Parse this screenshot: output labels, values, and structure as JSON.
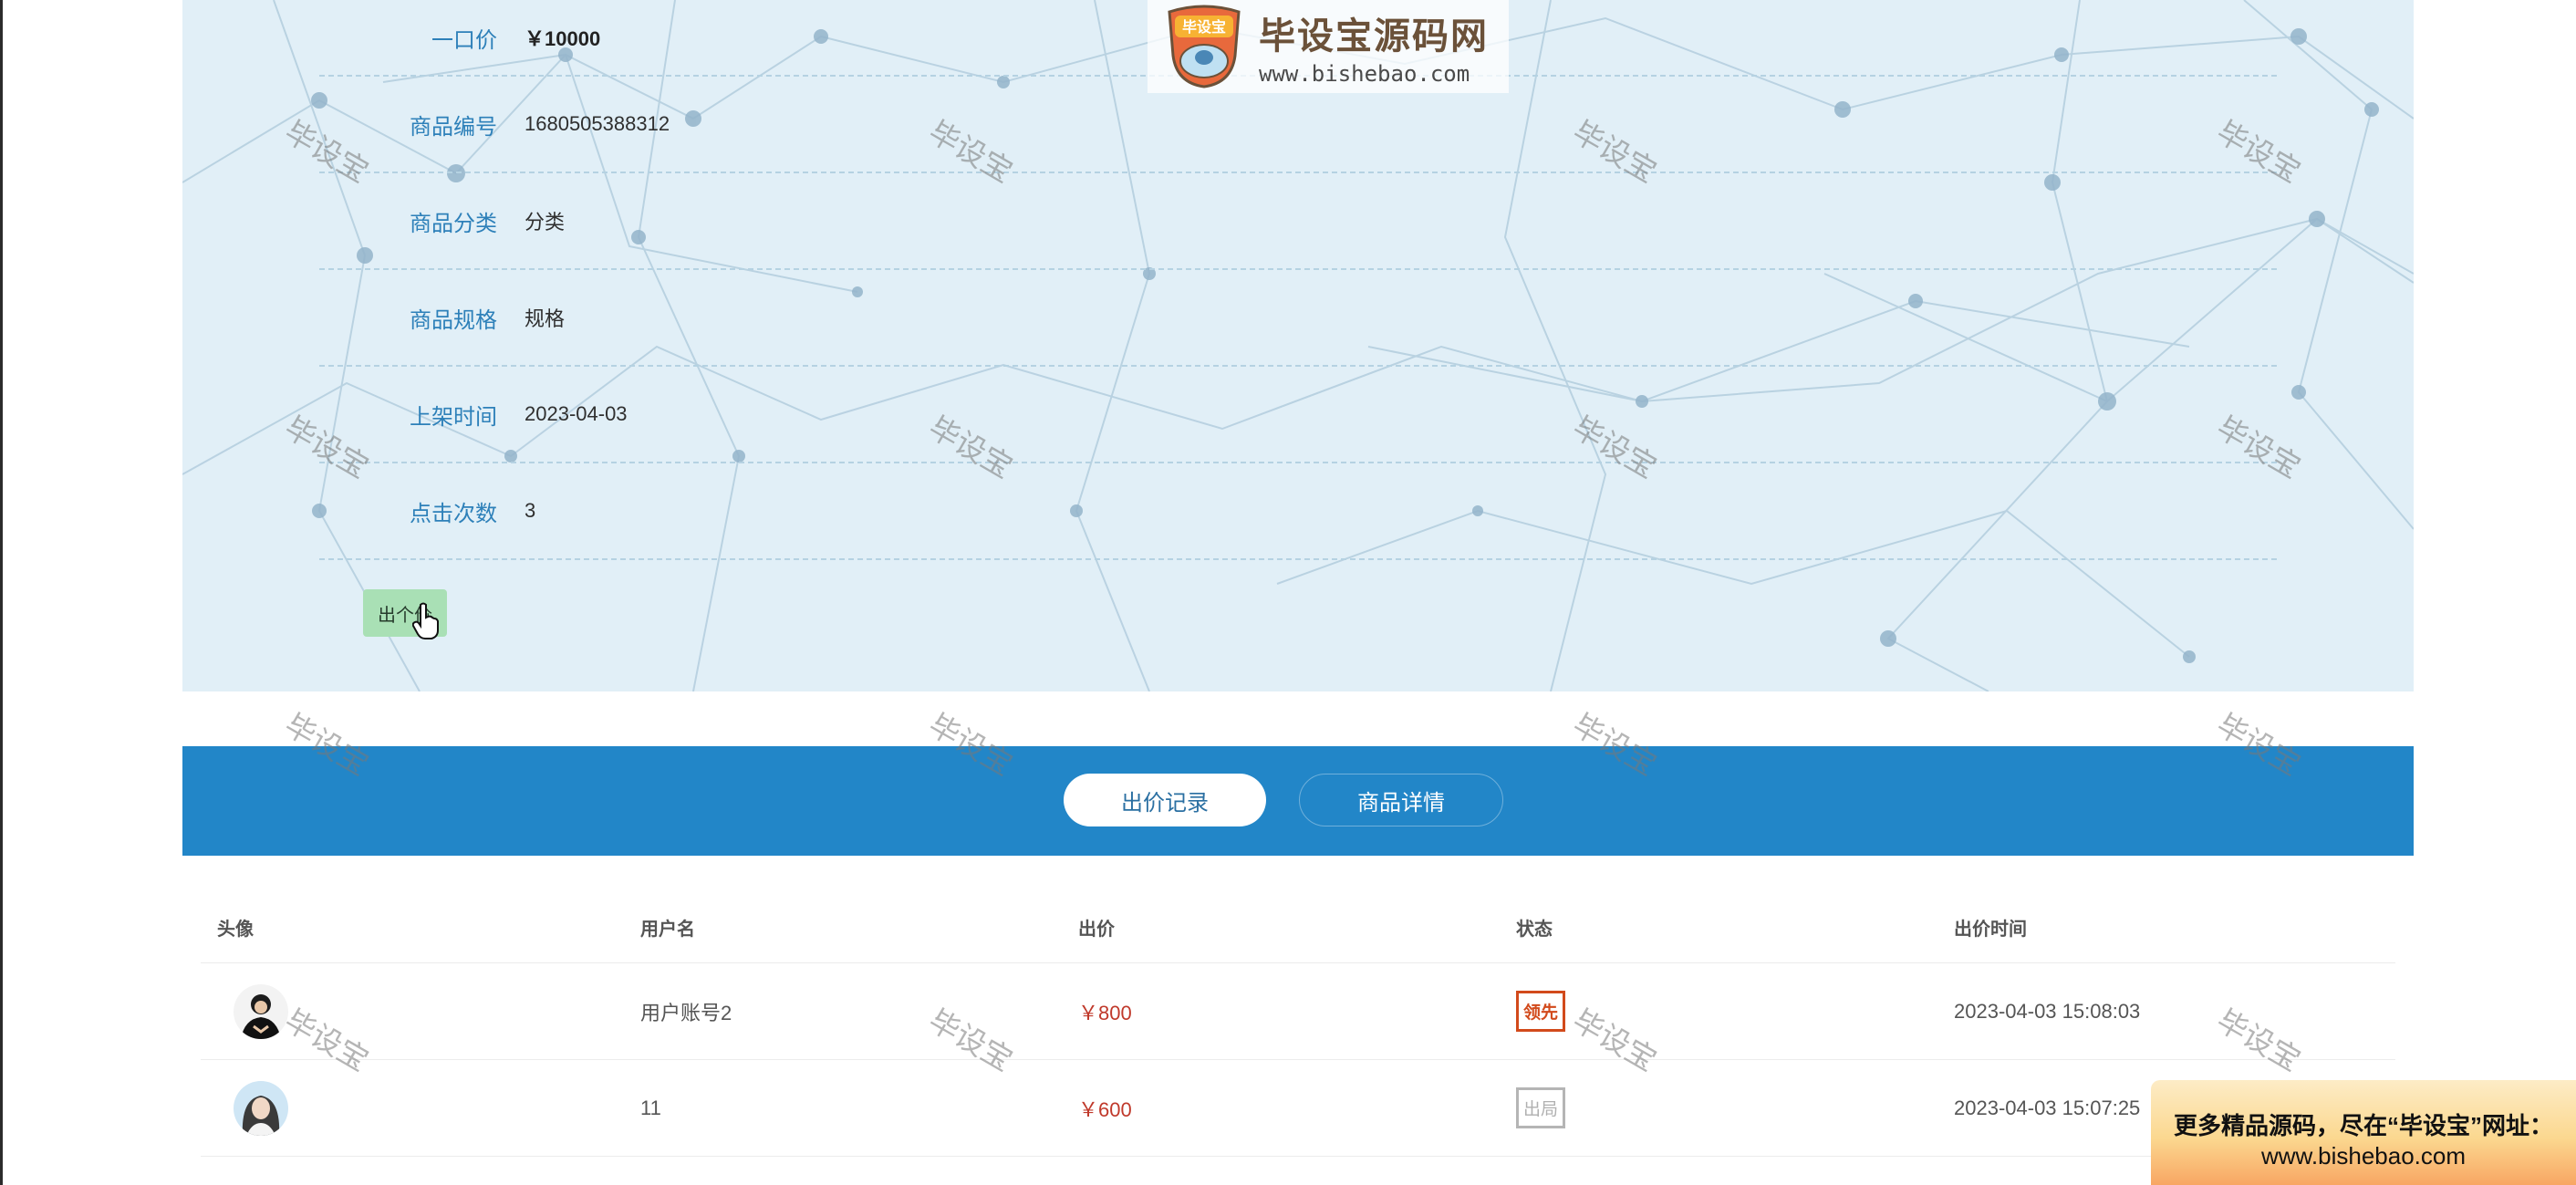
{
  "logo": {
    "title": "毕设宝源码网",
    "url": "www.bishebao.com",
    "badge": "毕设宝"
  },
  "product_info": [
    {
      "label": "一口价",
      "value": "￥10000"
    },
    {
      "label": "商品编号",
      "value": "1680505388312"
    },
    {
      "label": "商品分类",
      "value": "分类"
    },
    {
      "label": "商品规格",
      "value": "规格"
    },
    {
      "label": "上架时间",
      "value": "2023-04-03"
    },
    {
      "label": "点击次数",
      "value": "3"
    }
  ],
  "actions": {
    "bid_label": "出个价"
  },
  "tabs": [
    {
      "label": "出价记录",
      "active": true
    },
    {
      "label": "商品详情",
      "active": false
    }
  ],
  "bids_table": {
    "headers": [
      "头像",
      "用户名",
      "出价",
      "状态",
      "出价时间"
    ],
    "rows": [
      {
        "username": "用户账号2",
        "price": "￥800",
        "status": "领先",
        "time": "2023-04-03 15:08:03"
      },
      {
        "username": "11",
        "price": "￥600",
        "status": "出局",
        "time": "2023-04-03 15:07:25"
      }
    ]
  },
  "watermark": "毕设宝",
  "promo": {
    "line1": "更多精品源码，尽在“毕设宝”网址：",
    "line2": "www.bishebao.com"
  },
  "colors": {
    "panel_bg": "#e1eff7",
    "label_blue": "#2d80b9",
    "tabs_bar": "#2286c8",
    "bid_button": "#a9e0b5",
    "price_red": "#c0392b",
    "status_lead": "#d24a1b",
    "status_out": "#b0b0b0"
  }
}
